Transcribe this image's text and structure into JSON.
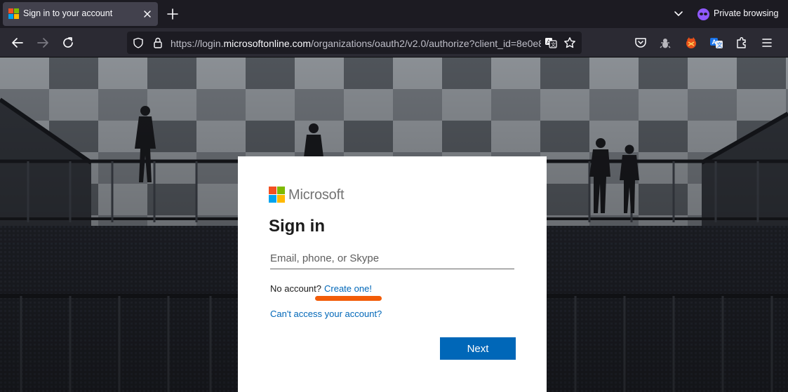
{
  "browser": {
    "tab": {
      "title": "Sign in to your account"
    },
    "private_label": "Private browsing",
    "url": {
      "prefix": "https://login.",
      "domain": "microsoftonline.com",
      "path": "/organizations/oauth2/v2.0/authorize?client_id=8e0e8"
    }
  },
  "signin": {
    "brand": "Microsoft",
    "title": "Sign in",
    "email_placeholder": "Email, phone, or Skype",
    "email_value": "",
    "no_account_text": "No account?",
    "create_link": "Create one!",
    "cant_access_link": "Can't access your account?",
    "next_button": "Next"
  },
  "colors": {
    "ms_red": "#f25022",
    "ms_green": "#7fba00",
    "ms_blue": "#00a4ef",
    "ms_yellow": "#ffb900",
    "link_blue": "#0067b8",
    "annotation_orange": "#f25c08",
    "private_purple": "#9059ff"
  }
}
